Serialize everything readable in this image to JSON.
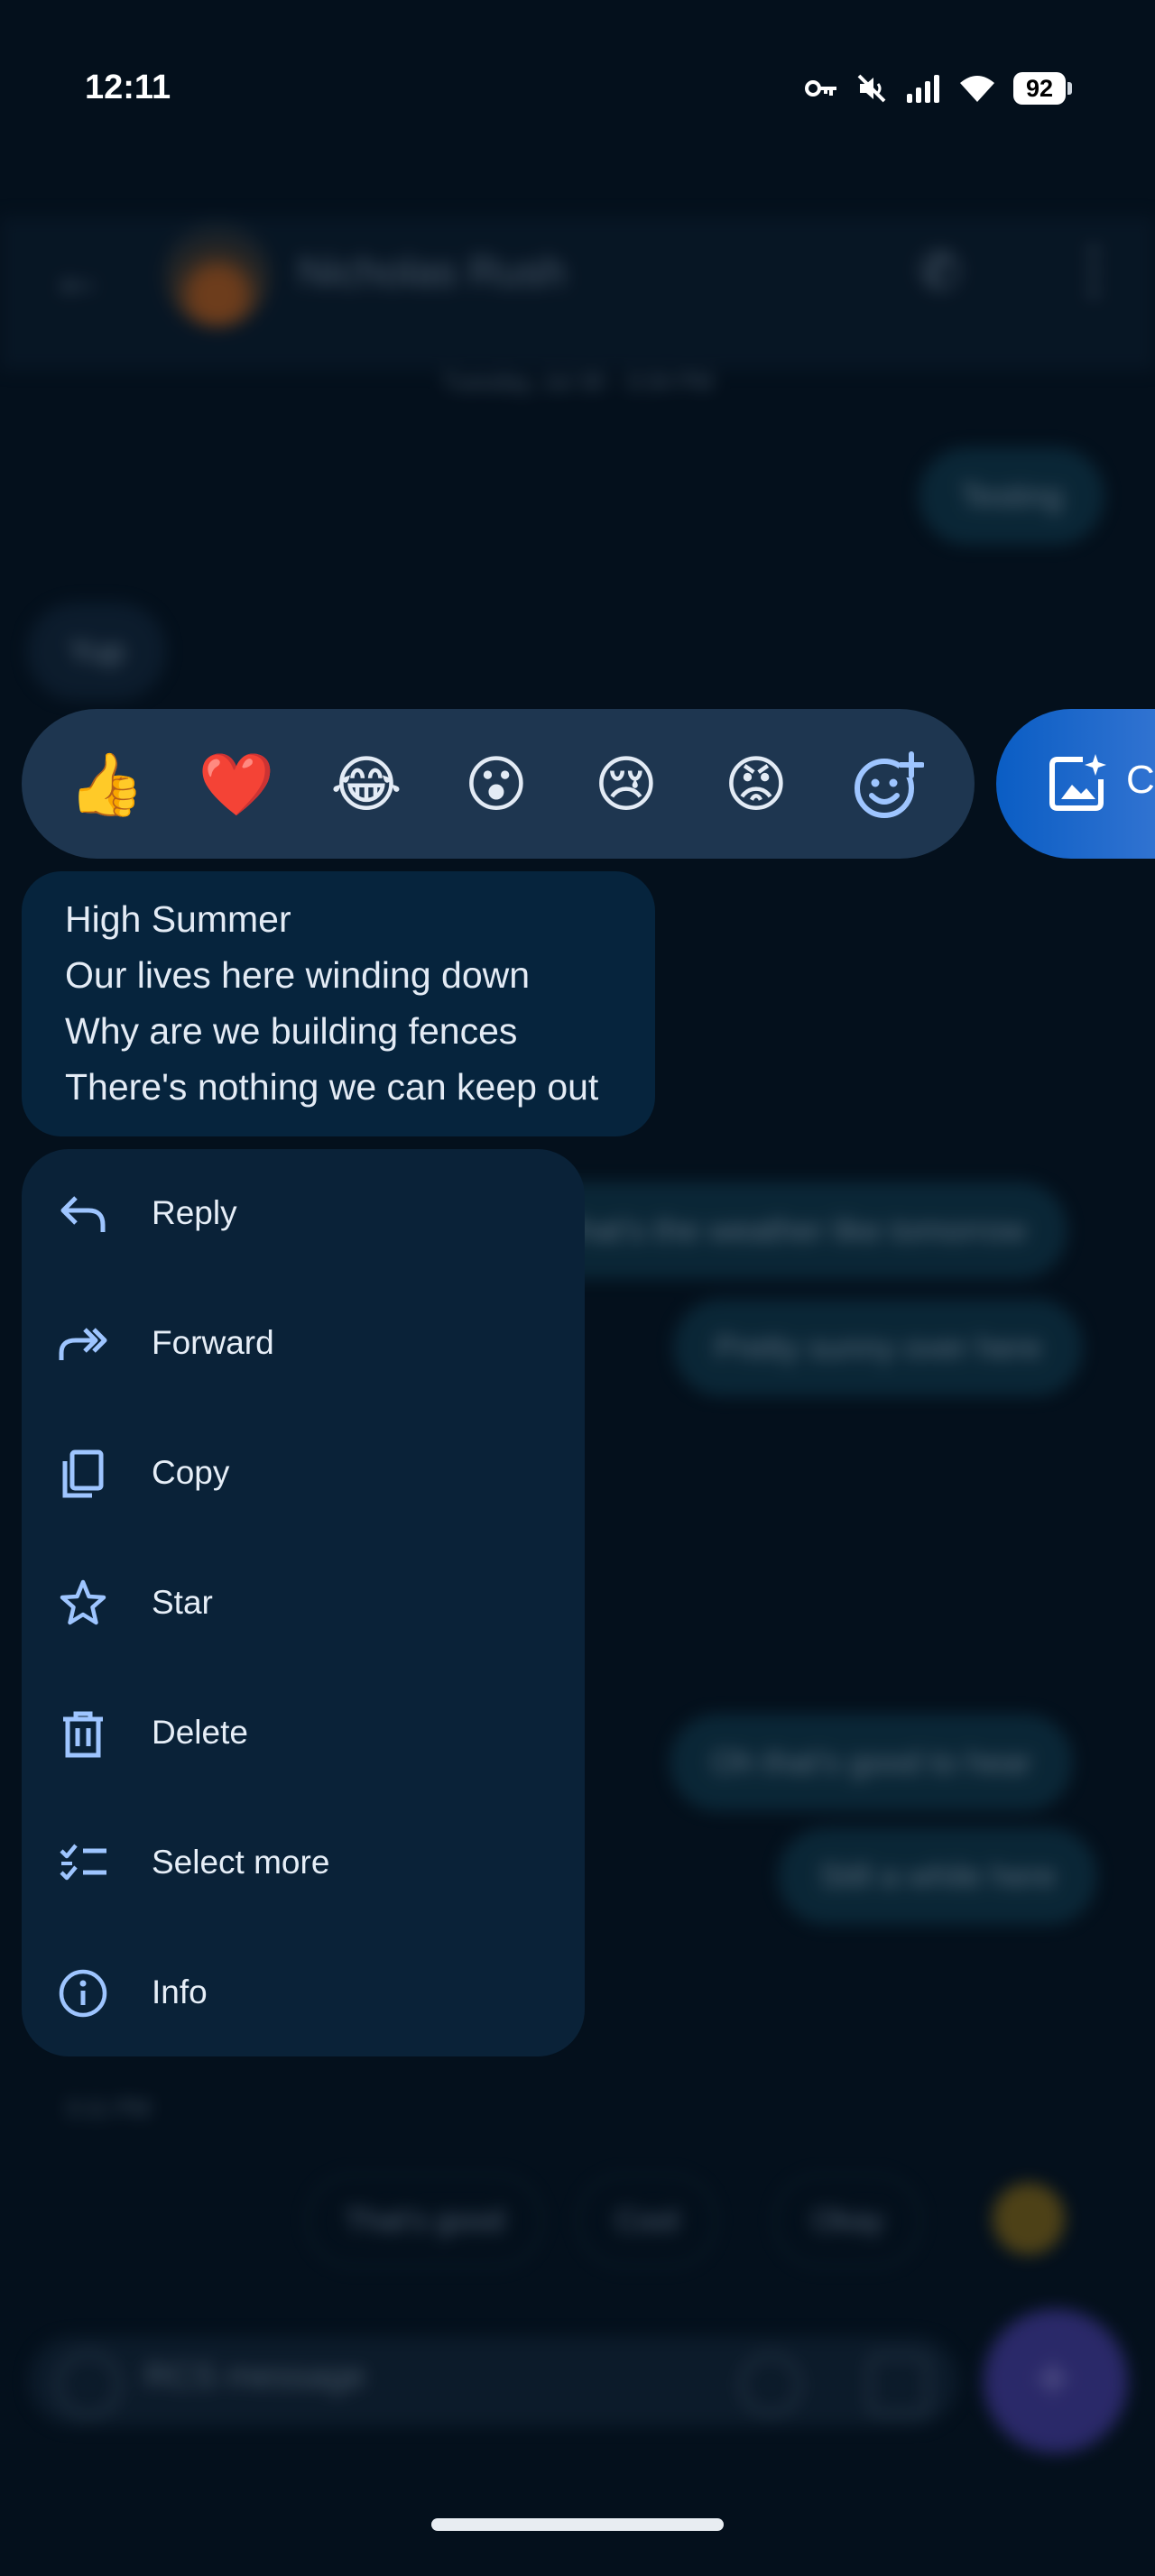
{
  "status_bar": {
    "time": "12:11",
    "battery": "92",
    "icons": [
      "vpn-key-icon",
      "mute-icon",
      "signal-icon",
      "wifi-icon",
      "battery-icon"
    ]
  },
  "background": {
    "contact_name": "Nicholas Rush",
    "date_label": "Tuesday, Jul 30 · 3:34 PM",
    "messages": [
      {
        "text": "Testing",
        "direction": "out"
      },
      {
        "text": "Yup",
        "direction": "in"
      },
      {
        "text": "What's the weather like tomorrow",
        "direction": "out"
      },
      {
        "text": "Pretty sunny over here",
        "direction": "out"
      },
      {
        "text": "Oh that's good to hear",
        "direction": "out"
      },
      {
        "text": "Still a while here",
        "direction": "out"
      }
    ],
    "timestamp": "3:11 PM",
    "smart_replies": [
      "That's good",
      "Cool",
      "Okay"
    ],
    "compose_placeholder": "RCS message"
  },
  "reactions": {
    "items": [
      {
        "name": "thumbs-up",
        "glyph": "👍"
      },
      {
        "name": "heart",
        "glyph": "❤️"
      },
      {
        "name": "laughing",
        "glyph": "😂"
      },
      {
        "name": "surprised",
        "glyph": "😮"
      },
      {
        "name": "crying",
        "glyph": "😢"
      },
      {
        "name": "angry",
        "glyph": "😡"
      }
    ],
    "add_icon": "add-reaction-icon",
    "create_label": "Cr"
  },
  "message": {
    "lines": [
      "High Summer",
      "Our lives here winding down",
      "Why are we building fences",
      "There's nothing we can keep out"
    ]
  },
  "menu": {
    "items": [
      {
        "label": "Reply",
        "icon": "reply-icon"
      },
      {
        "label": "Forward",
        "icon": "forward-icon"
      },
      {
        "label": "Copy",
        "icon": "copy-icon"
      },
      {
        "label": "Star",
        "icon": "star-icon"
      },
      {
        "label": "Delete",
        "icon": "delete-icon"
      },
      {
        "label": "Select more",
        "icon": "select-more-icon"
      },
      {
        "label": "Info",
        "icon": "info-icon"
      }
    ]
  },
  "colors": {
    "background": "#04101c",
    "reaction_bar": "#1e3650",
    "bubble": "#06243d",
    "menu": "#0a2238",
    "accent": "#9ec5ff",
    "create_button": "#0a5dc4"
  }
}
